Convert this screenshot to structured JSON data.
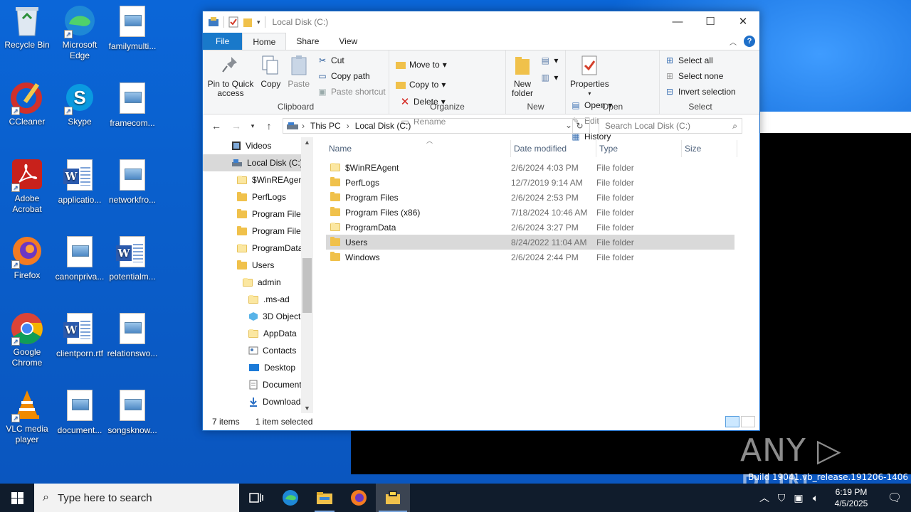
{
  "desktop": {
    "icons": [
      {
        "label": "Recycle Bin",
        "icon": "recycle-bin-icon"
      },
      {
        "label": "Microsoft Edge",
        "icon": "edge-icon"
      },
      {
        "label": "familymulti...",
        "icon": "image-file-icon"
      },
      {
        "label": "CCleaner",
        "icon": "ccleaner-icon"
      },
      {
        "label": "Skype",
        "icon": "skype-icon"
      },
      {
        "label": "framecom...",
        "icon": "image-file-icon"
      },
      {
        "label": "Adobe Acrobat",
        "icon": "acrobat-icon"
      },
      {
        "label": "applicatio...",
        "icon": "word-doc-icon"
      },
      {
        "label": "networkfro...",
        "icon": "image-file-icon"
      },
      {
        "label": "Firefox",
        "icon": "firefox-icon"
      },
      {
        "label": "canonpriva...",
        "icon": "image-file-icon"
      },
      {
        "label": "potentialm...",
        "icon": "word-doc-icon"
      },
      {
        "label": "Google Chrome",
        "icon": "chrome-icon"
      },
      {
        "label": "clientporn.rtf",
        "icon": "word-doc-icon"
      },
      {
        "label": "relationswo...",
        "icon": "image-file-icon"
      },
      {
        "label": "VLC media player",
        "icon": "vlc-icon"
      },
      {
        "label": "document...",
        "icon": "image-file-icon"
      },
      {
        "label": "songsknow...",
        "icon": "image-file-icon"
      }
    ],
    "watermark": "ANY ▷ RUN",
    "build_text": "Build 19041.vb_release.191206-1406"
  },
  "explorer": {
    "title": "Local Disk (C:)",
    "tabs": [
      "File",
      "Home",
      "Share",
      "View"
    ],
    "active_tab": "Home",
    "ribbon": {
      "clipboard": {
        "label": "Clipboard",
        "pin": "Pin to Quick access",
        "copy": "Copy",
        "paste": "Paste",
        "cut": "Cut",
        "copy_path": "Copy path",
        "paste_shortcut": "Paste shortcut"
      },
      "organize": {
        "label": "Organize",
        "move_to": "Move to",
        "copy_to": "Copy to",
        "delete": "Delete",
        "rename": "Rename"
      },
      "new": {
        "label": "New",
        "new_folder": "New folder"
      },
      "open": {
        "label": "Open",
        "properties": "Properties",
        "open": "Open",
        "edit": "Edit",
        "history": "History"
      },
      "select": {
        "label": "Select",
        "select_all": "Select all",
        "select_none": "Select none",
        "invert": "Invert selection"
      }
    },
    "address": {
      "crumb1": "This PC",
      "crumb2": "Local Disk (C:)",
      "search_placeholder": "Search Local Disk (C:)"
    },
    "nav_items": [
      {
        "label": "Videos",
        "indent": 1,
        "kind": "video"
      },
      {
        "label": "Local Disk (C:)",
        "indent": 1,
        "kind": "disk",
        "selected": true
      },
      {
        "label": "$WinREAgent",
        "indent": 2,
        "kind": "folder-light"
      },
      {
        "label": "PerfLogs",
        "indent": 2,
        "kind": "folder"
      },
      {
        "label": "Program Files",
        "indent": 2,
        "kind": "folder"
      },
      {
        "label": "Program Files",
        "indent": 2,
        "kind": "folder"
      },
      {
        "label": "ProgramData",
        "indent": 2,
        "kind": "folder-light"
      },
      {
        "label": "Users",
        "indent": 2,
        "kind": "folder"
      },
      {
        "label": "admin",
        "indent": 3,
        "kind": "folder-light"
      },
      {
        "label": ".ms-ad",
        "indent": 4,
        "kind": "folder-light"
      },
      {
        "label": "3D Objects",
        "indent": 4,
        "kind": "3d"
      },
      {
        "label": "AppData",
        "indent": 4,
        "kind": "folder-light"
      },
      {
        "label": "Contacts",
        "indent": 4,
        "kind": "contacts"
      },
      {
        "label": "Desktop",
        "indent": 4,
        "kind": "desktop"
      },
      {
        "label": "Documents",
        "indent": 4,
        "kind": "docs"
      },
      {
        "label": "Downloads",
        "indent": 4,
        "kind": "download"
      }
    ],
    "columns": [
      "Name",
      "Date modified",
      "Type",
      "Size"
    ],
    "files": [
      {
        "name": "$WinREAgent",
        "date": "2/6/2024 4:03 PM",
        "type": "File folder",
        "light": true
      },
      {
        "name": "PerfLogs",
        "date": "12/7/2019 9:14 AM",
        "type": "File folder"
      },
      {
        "name": "Program Files",
        "date": "2/6/2024 2:53 PM",
        "type": "File folder"
      },
      {
        "name": "Program Files (x86)",
        "date": "7/18/2024 10:46 AM",
        "type": "File folder"
      },
      {
        "name": "ProgramData",
        "date": "2/6/2024 3:27 PM",
        "type": "File folder",
        "light": true
      },
      {
        "name": "Users",
        "date": "8/24/2022 11:04 AM",
        "type": "File folder",
        "selected": true
      },
      {
        "name": "Windows",
        "date": "2/6/2024 2:44 PM",
        "type": "File folder"
      }
    ],
    "status": {
      "count": "7 items",
      "selected": "1 item selected"
    }
  },
  "taskbar": {
    "search_placeholder": "Type here to search",
    "time": "6:19 PM",
    "date": "4/5/2025"
  },
  "colors": {
    "accent": "#1979ca",
    "desktop": "#0a5fcc",
    "taskbar": "#101c2c",
    "folder": "#f0c14b"
  }
}
